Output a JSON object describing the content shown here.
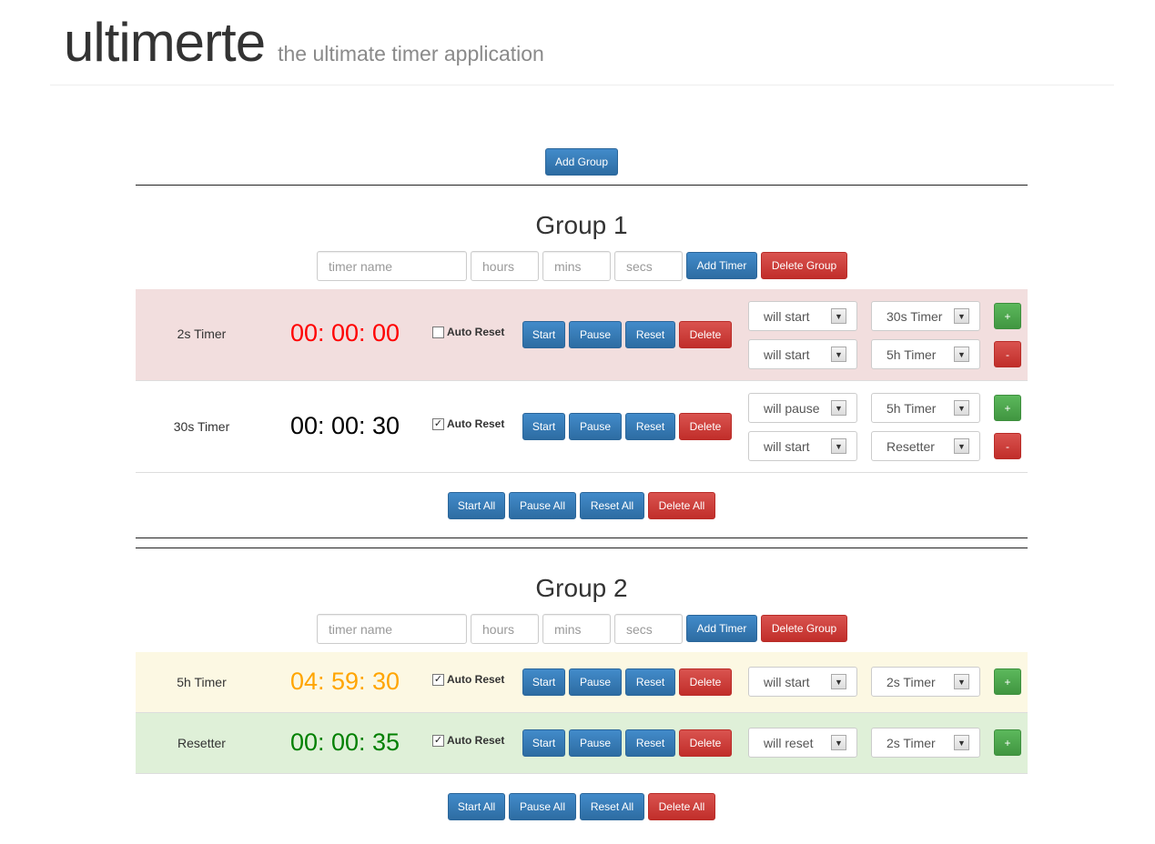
{
  "app": {
    "title": "ultimerte",
    "subtitle": "the ultimate timer application"
  },
  "add_group_label": "Add Group",
  "form": {
    "name_placeholder": "timer name",
    "hours_placeholder": "hours",
    "mins_placeholder": "mins",
    "secs_placeholder": "secs",
    "add_timer_label": "Add Timer",
    "delete_group_label": "Delete Group"
  },
  "row_buttons": {
    "start": "Start",
    "pause": "Pause",
    "reset": "Reset",
    "delete": "Delete",
    "auto_reset": "Auto Reset",
    "add_rule": "+",
    "remove_rule": "-"
  },
  "group_buttons": {
    "start_all": "Start All",
    "pause_all": "Pause All",
    "reset_all": "Reset All",
    "delete_all": "Delete All"
  },
  "colors": {
    "red": "#ff0000",
    "black": "#000000",
    "orange": "#ffa500",
    "green": "#008000",
    "row_red_bg": "#f2dede",
    "row_yellow_bg": "#fcf8e3",
    "row_green_bg": "#dff0d8"
  },
  "groups": [
    {
      "title": "Group 1",
      "timers": [
        {
          "name": "2s Timer",
          "time": "00: 00: 00",
          "auto_reset": false,
          "rules": [
            {
              "action": "will start",
              "target": "30s Timer"
            },
            {
              "action": "will start",
              "target": "5h Timer"
            }
          ]
        },
        {
          "name": "30s Timer",
          "time": "00: 00: 30",
          "auto_reset": true,
          "rules": [
            {
              "action": "will pause",
              "target": "5h Timer"
            },
            {
              "action": "will start",
              "target": "Resetter"
            }
          ]
        }
      ]
    },
    {
      "title": "Group 2",
      "timers": [
        {
          "name": "5h Timer",
          "time": "04: 59: 30",
          "auto_reset": true,
          "rules": [
            {
              "action": "will start",
              "target": "2s Timer"
            }
          ]
        },
        {
          "name": "Resetter",
          "time": "00: 00: 35",
          "auto_reset": true,
          "rules": [
            {
              "action": "will reset",
              "target": "2s Timer"
            }
          ]
        }
      ]
    }
  ]
}
